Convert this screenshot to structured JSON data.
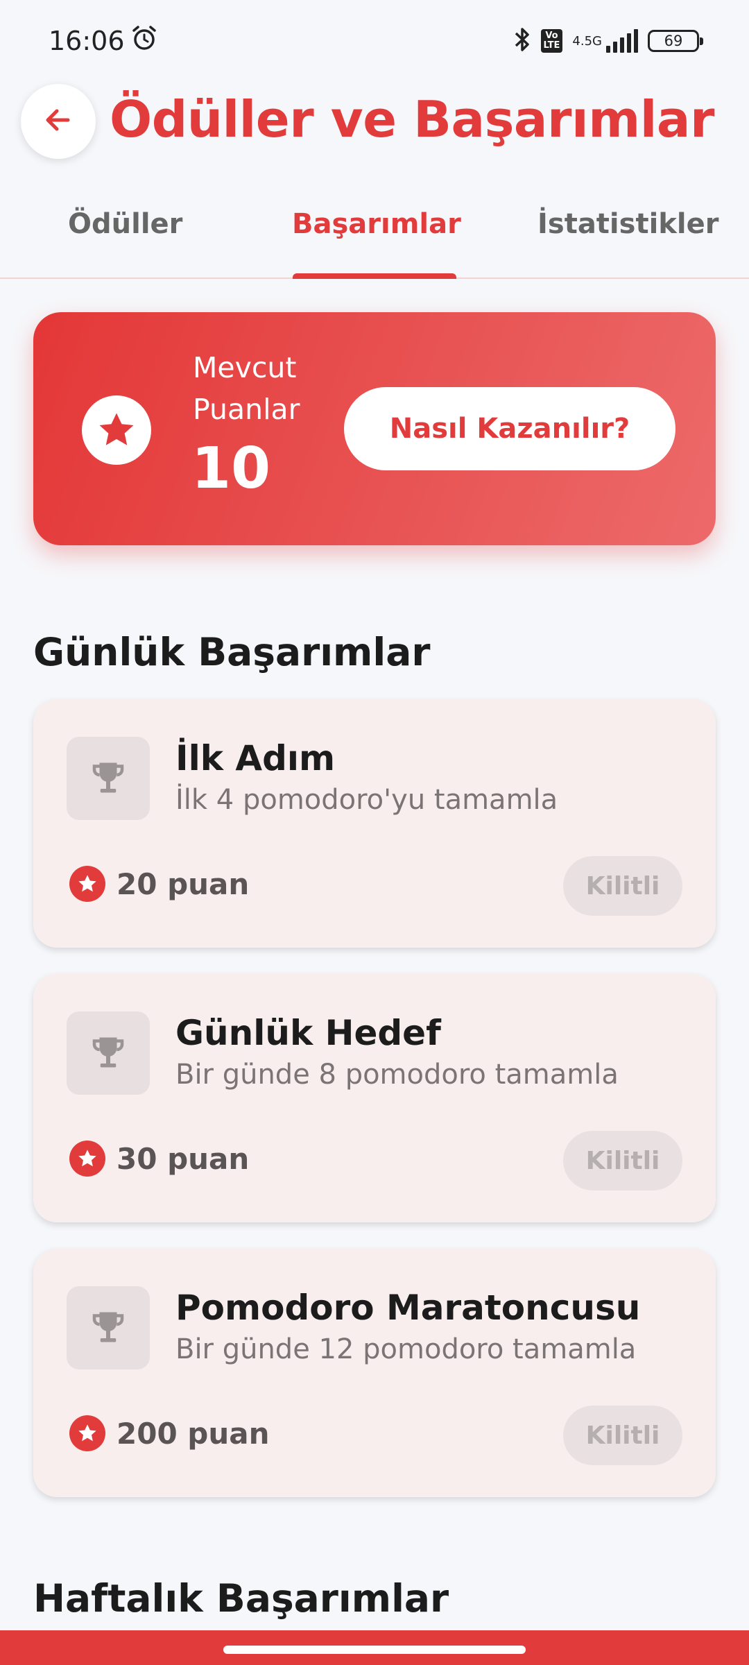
{
  "status_bar": {
    "time": "16:06",
    "network_tag": "Vo\nLTE",
    "network_gen": "4.5G",
    "battery": "69",
    "icons": [
      "alarm-icon",
      "bluetooth-icon",
      "volte-icon",
      "signal-icon",
      "battery-icon"
    ]
  },
  "header": {
    "title": "Ödüller ve Başarımlar",
    "back_icon": "arrow-left-icon"
  },
  "tabs": [
    {
      "label": "Ödüller",
      "active": false
    },
    {
      "label": "Başarımlar",
      "active": true
    },
    {
      "label": "İstatistikler",
      "active": false
    }
  ],
  "points_card": {
    "label": "Mevcut Puanlar",
    "value": "10",
    "button_label": "Nasıl Kazanılır?",
    "icon": "star-icon"
  },
  "sections": [
    {
      "title": "Günlük Başarımlar",
      "achievements": [
        {
          "title": "İlk Adım",
          "description": "İlk 4 pomodoro'yu tamamla",
          "points": "20 puan",
          "status": "Kilitli",
          "icon": "trophy-icon"
        },
        {
          "title": "Günlük Hedef",
          "description": "Bir günde 8 pomodoro tamamla",
          "points": "30 puan",
          "status": "Kilitli",
          "icon": "trophy-icon"
        },
        {
          "title": "Pomodoro Maratoncusu",
          "description": "Bir günde 12 pomodoro tamamla",
          "points": "200 puan",
          "status": "Kilitli",
          "icon": "trophy-icon"
        }
      ]
    },
    {
      "title": "Haftalık Başarımlar",
      "achievements": []
    }
  ],
  "colors": {
    "accent": "#e23b3b",
    "background": "#f6f7fa",
    "card": "#f8eeee"
  }
}
